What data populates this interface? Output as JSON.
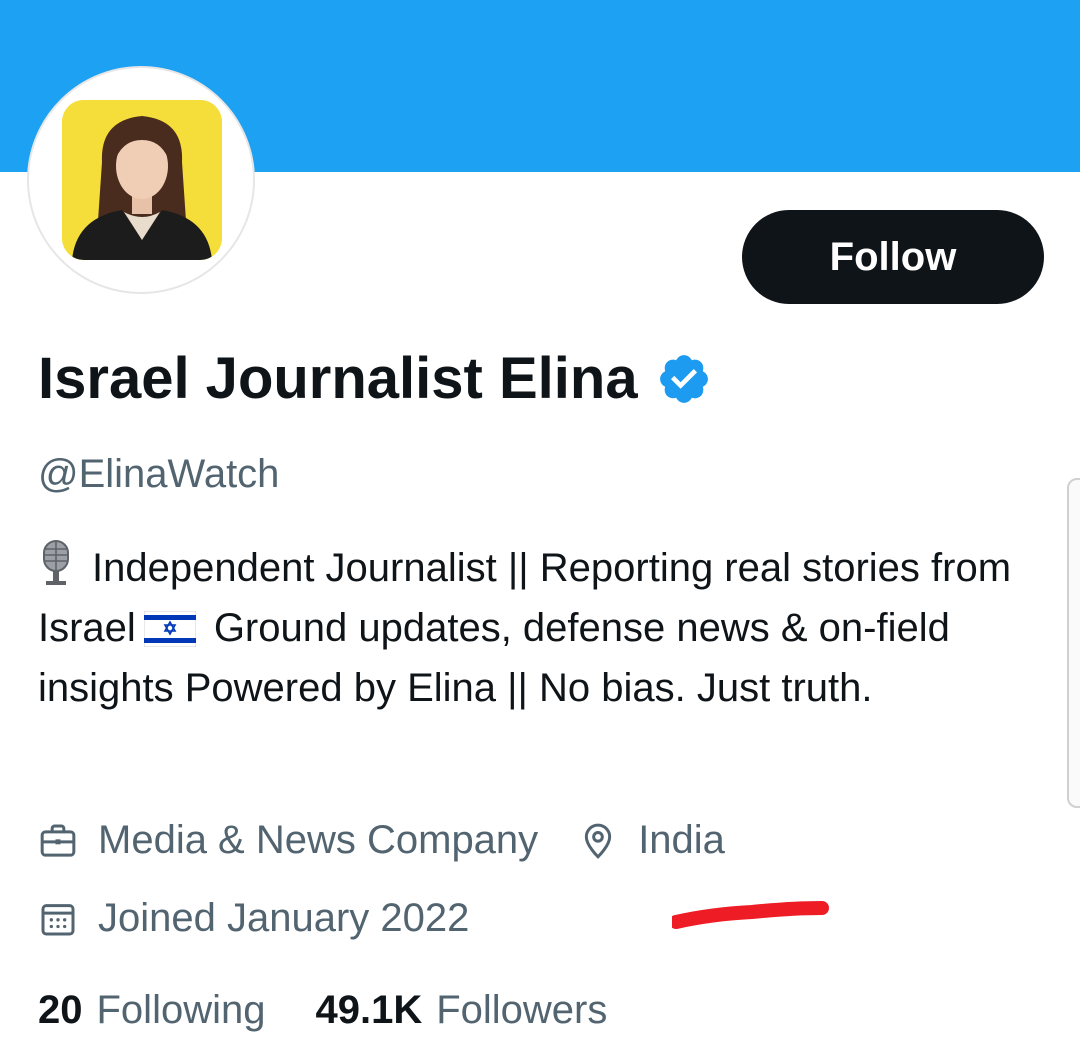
{
  "profile": {
    "display_name": "Israel Journalist Elina",
    "handle": "@ElinaWatch",
    "follow_label": "Follow",
    "bio": {
      "mic_icon": "studio-microphone-emoji",
      "part1": "Independent Journalist || Reporting real stories from Israel",
      "flag_icon": "israel-flag-emoji",
      "part2": "Ground updates, defense news & on-field insights Powered by Elina || No bias. Just truth."
    },
    "category": "Media & News Company",
    "location": "India",
    "joined": "Joined January 2022",
    "following_count": "20",
    "following_label": "Following",
    "followers_count": "49.1K",
    "followers_label": "Followers"
  },
  "icons": {
    "verified": "verified-badge-icon",
    "category": "briefcase-icon",
    "location": "location-pin-icon",
    "joined": "calendar-icon"
  },
  "colors": {
    "banner": "#1da1f2",
    "follow_button": "#0f1419",
    "verified": "#1d9bf0",
    "secondary_text": "#536471",
    "annotation": "#ee1c25"
  }
}
